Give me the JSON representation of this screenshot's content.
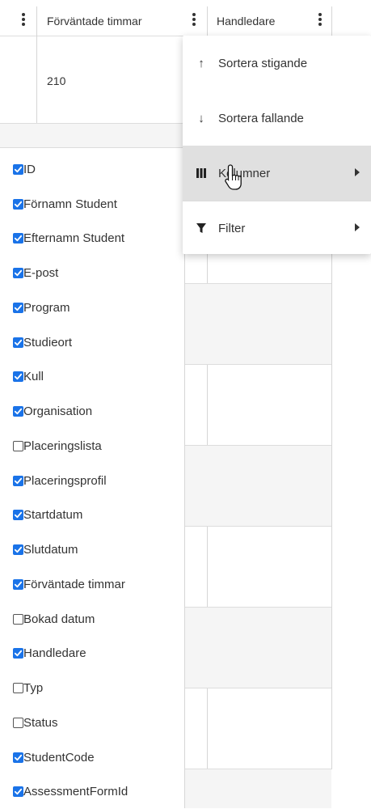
{
  "grid": {
    "columns": [
      {
        "label": "Förväntade timmar"
      },
      {
        "label": "Handledare"
      }
    ],
    "first_row_value": "210"
  },
  "column_chooser": {
    "items": [
      {
        "label": "ID",
        "checked": true
      },
      {
        "label": "Förnamn Student",
        "checked": true
      },
      {
        "label": "Efternamn Student",
        "checked": true
      },
      {
        "label": "E-post",
        "checked": true
      },
      {
        "label": "Program",
        "checked": true
      },
      {
        "label": "Studieort",
        "checked": true
      },
      {
        "label": "Kull",
        "checked": true
      },
      {
        "label": "Organisation",
        "checked": true
      },
      {
        "label": "Placeringslista",
        "checked": false
      },
      {
        "label": "Placeringsprofil",
        "checked": true
      },
      {
        "label": "Startdatum",
        "checked": true
      },
      {
        "label": "Slutdatum",
        "checked": true
      },
      {
        "label": "Förväntade timmar",
        "checked": true
      },
      {
        "label": "Bokad datum",
        "checked": false
      },
      {
        "label": "Handledare",
        "checked": true
      },
      {
        "label": "Typ",
        "checked": false
      },
      {
        "label": "Status",
        "checked": false
      },
      {
        "label": "StudentCode",
        "checked": true
      },
      {
        "label": "AssessmentFormId",
        "checked": true
      }
    ]
  },
  "menu": {
    "sort_asc": "Sortera stigande",
    "sort_desc": "Sortera fallande",
    "columns": "Kolumner",
    "filter": "Filter"
  },
  "colors": {
    "checkbox_accent": "#1a73e8",
    "menu_hover": "#e0e0e0"
  }
}
